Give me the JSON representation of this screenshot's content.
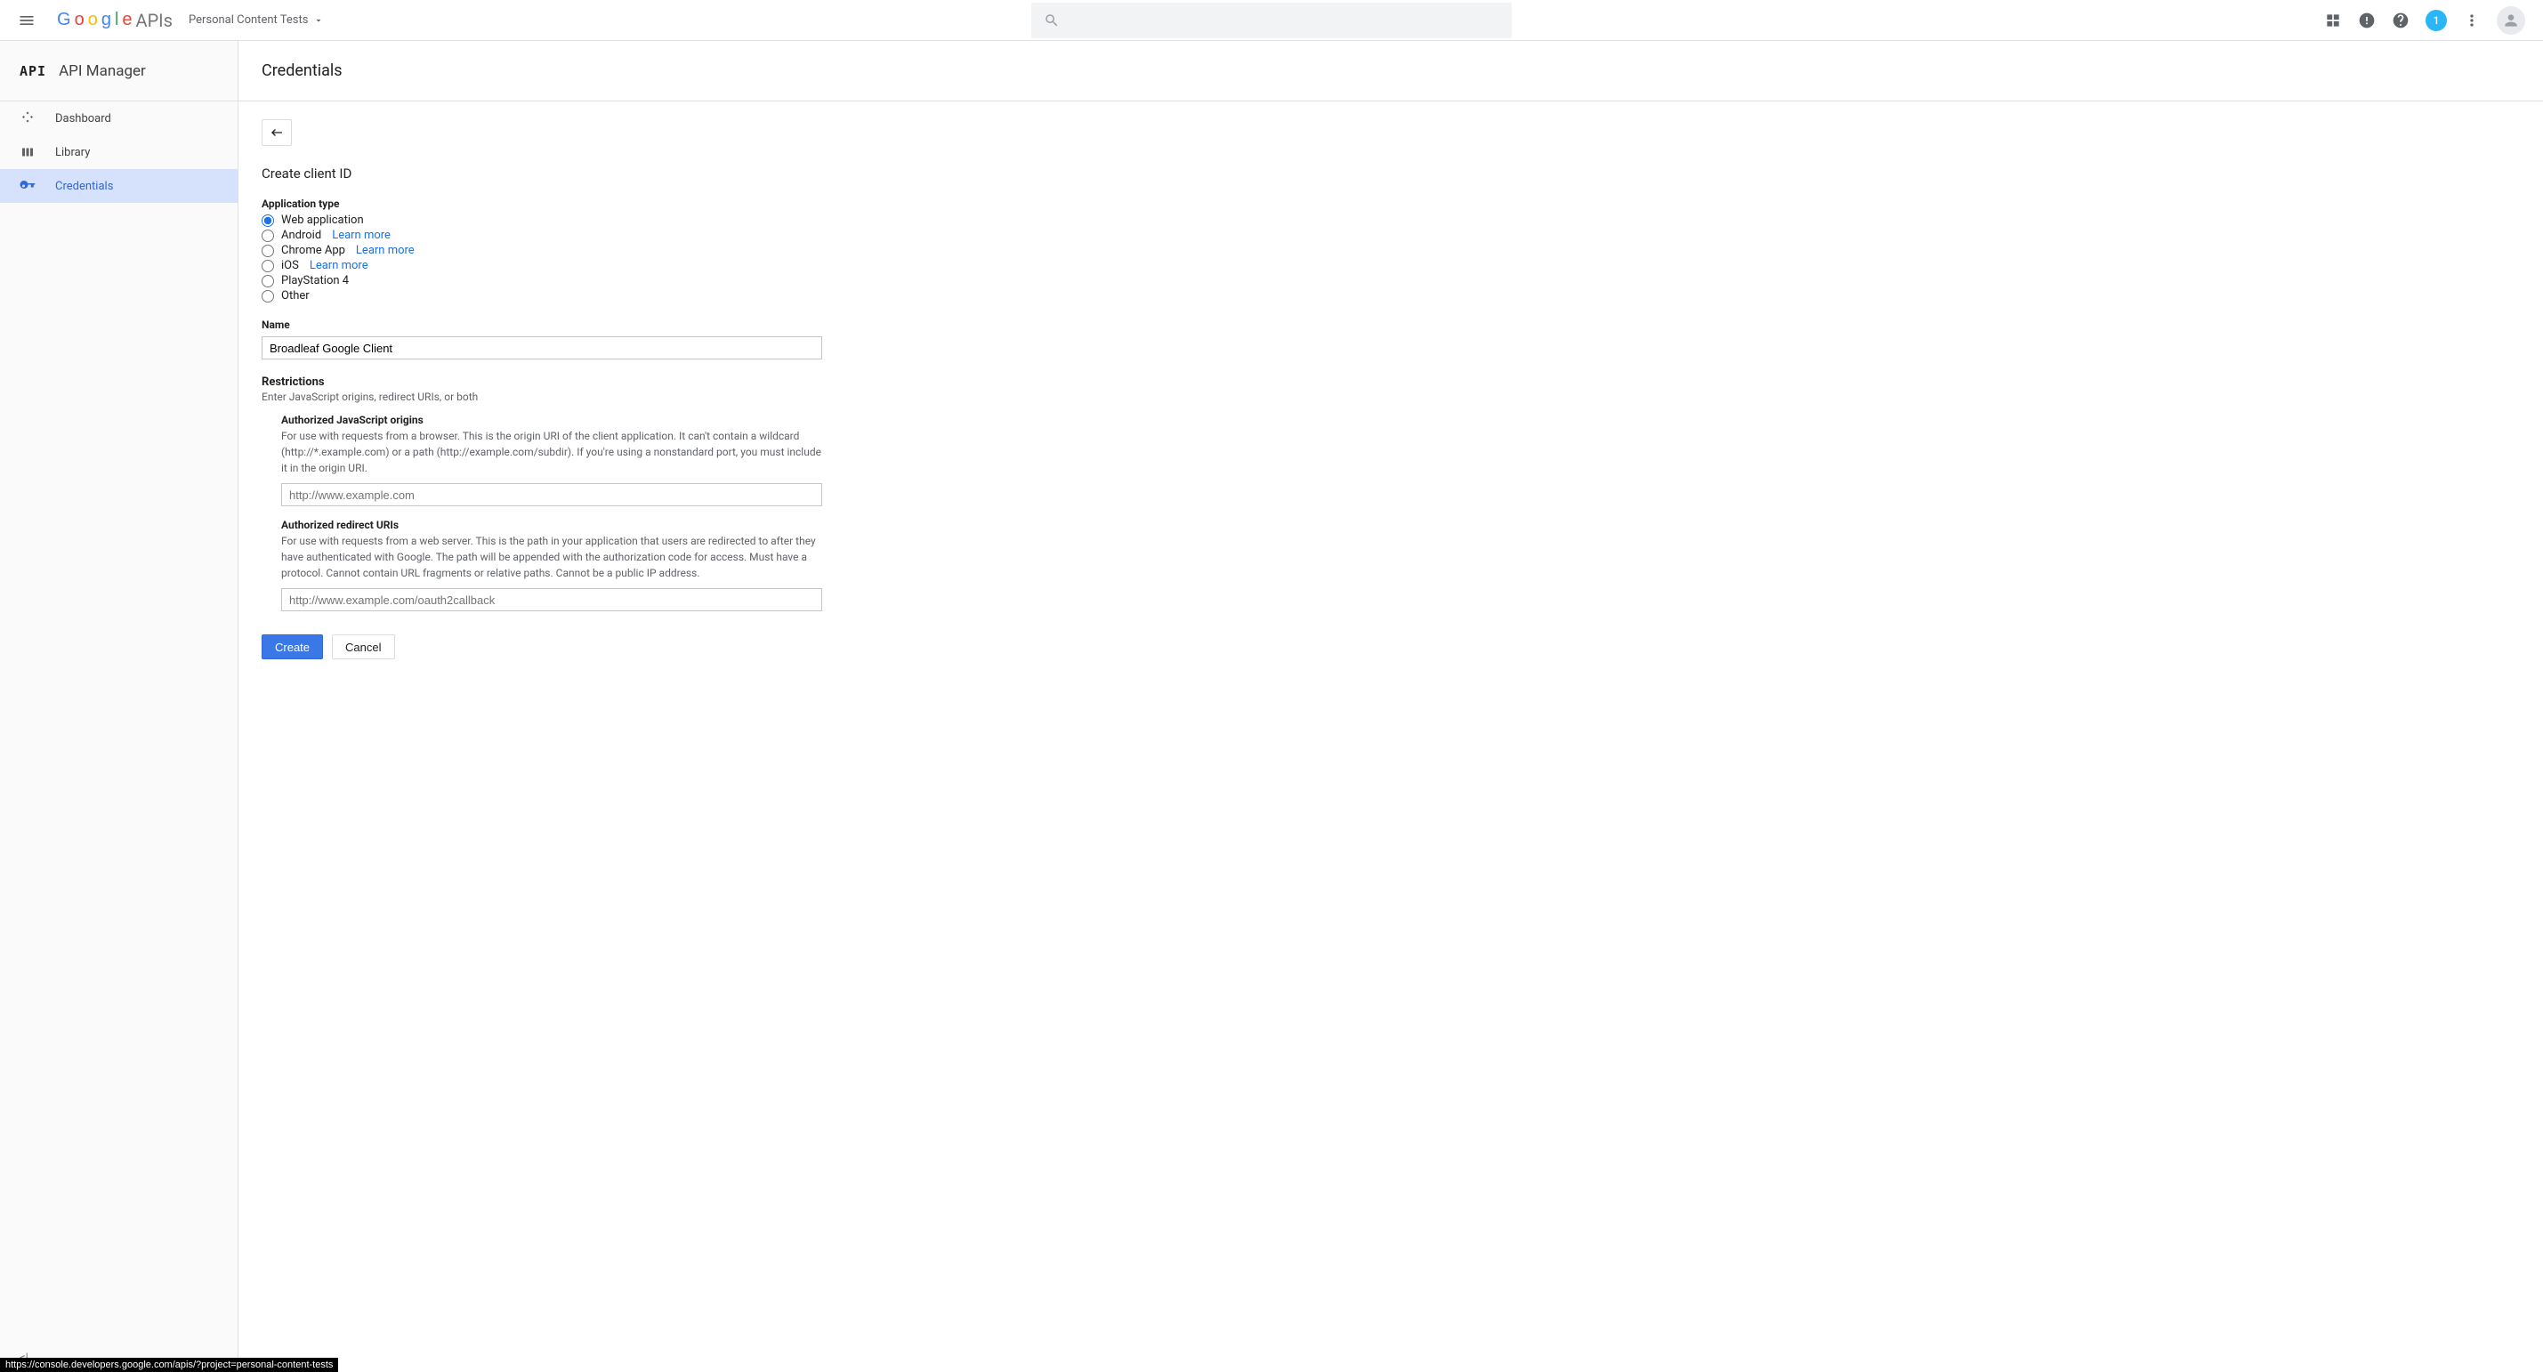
{
  "header": {
    "logo_text": "APIs",
    "project_name": "Personal Content Tests",
    "search_placeholder": "",
    "notification_badge": "1"
  },
  "sidebar": {
    "logo": "API",
    "title": "API Manager",
    "items": [
      {
        "label": "Dashboard",
        "active": false,
        "icon": "dashboard"
      },
      {
        "label": "Library",
        "active": false,
        "icon": "library"
      },
      {
        "label": "Credentials",
        "active": true,
        "icon": "key"
      }
    ],
    "collapse": "<|"
  },
  "main": {
    "page_title": "Credentials",
    "subtitle": "Create client ID",
    "app_type": {
      "label": "Application type",
      "options": [
        {
          "label": "Web application",
          "learn_more": null,
          "selected": true
        },
        {
          "label": "Android",
          "learn_more": "Learn more",
          "selected": false
        },
        {
          "label": "Chrome App",
          "learn_more": "Learn more",
          "selected": false
        },
        {
          "label": "iOS",
          "learn_more": "Learn more",
          "selected": false
        },
        {
          "label": "PlayStation 4",
          "learn_more": null,
          "selected": false
        },
        {
          "label": "Other",
          "learn_more": null,
          "selected": false
        }
      ]
    },
    "name_field": {
      "label": "Name",
      "value": "Broadleaf Google Client"
    },
    "restrictions": {
      "heading": "Restrictions",
      "subheading": "Enter JavaScript origins, redirect URIs, or both",
      "js_origins": {
        "title": "Authorized JavaScript origins",
        "desc": "For use with requests from a browser. This is the origin URI of the client application. It can't contain a wildcard (http://*.example.com) or a path (http://example.com/subdir). If you're using a nonstandard port, you must include it in the origin URI.",
        "placeholder": "http://www.example.com",
        "value": ""
      },
      "redirect_uris": {
        "title": "Authorized redirect URIs",
        "desc": "For use with requests from a web server. This is the path in your application that users are redirected to after they have authenticated with Google. The path will be appended with the authorization code for access. Must have a protocol. Cannot contain URL fragments or relative paths. Cannot be a public IP address.",
        "placeholder": "http://www.example.com/oauth2callback",
        "value": ""
      }
    },
    "buttons": {
      "create": "Create",
      "cancel": "Cancel"
    }
  },
  "status_bar": "https://console.developers.google.com/apis/?project=personal-content-tests"
}
